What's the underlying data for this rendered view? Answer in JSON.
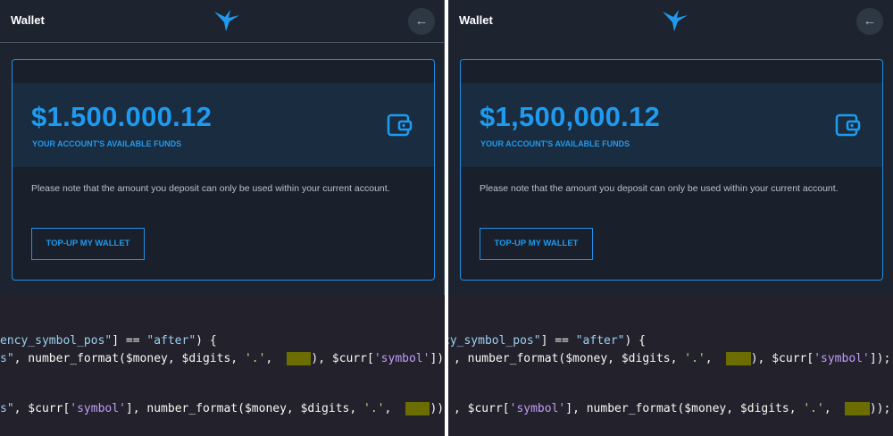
{
  "left": {
    "header": {
      "title": "Wallet",
      "back_icon": "arrow-left-icon",
      "logo_icon": "hummingbird-logo-icon"
    },
    "card": {
      "amount": "$1.500.000.12",
      "funds_label": "YOUR ACCOUNT'S AVAILABLE FUNDS",
      "note": "Please note that the amount you deposit can only be used within your current account.",
      "topup_label": "TOP-UP MY WALLET",
      "wallet_icon": "wallet-icon"
    },
    "code": {
      "line1_a": "ency_symbol_pos\"",
      "line1_b": "] == ",
      "line1_c": "\"after\"",
      "line1_d": ") {",
      "line2_a": "s\"",
      "line2_b": ", number_format($money, $digits, ",
      "line2_c": "'.'",
      "line2_d": ",  ",
      "line2_hl": "'.'",
      "line2_e": "), $curr[",
      "line2_f": "'symbol'",
      "line2_g": "]);",
      "line3_a": "s\"",
      "line3_b": ", $curr[",
      "line3_c": "'symbol'",
      "line3_d": "], number_format($money, $digits, ",
      "line3_e": "'.'",
      "line3_f": ",  ",
      "line3_hl": "'.'",
      "line3_g": "));"
    }
  },
  "right": {
    "header": {
      "title": "Wallet",
      "back_icon": "arrow-left-icon",
      "logo_icon": "hummingbird-logo-icon"
    },
    "card": {
      "amount": "$1,500,000.12",
      "funds_label": "YOUR ACCOUNT'S AVAILABLE FUNDS",
      "note": "Please note that the amount you deposit can only be used within your current account.",
      "topup_label": "TOP-UP MY WALLET",
      "wallet_icon": "wallet-icon"
    },
    "code": {
      "line1_a": "cy_symbol_pos\"",
      "line1_b": "] == ",
      "line1_c": "\"after\"",
      "line1_d": ") {",
      "line2_b": ", number_format($money, $digits, ",
      "line2_c": "'.'",
      "line2_d": ",  ",
      "line2_hl": "','",
      "line2_e": "), $curr[",
      "line2_f": "'symbol'",
      "line2_g": "]);",
      "line3_b": ", $curr[",
      "line3_c": "'symbol'",
      "line3_d": "], number_format($money, $digits, ",
      "line3_e": "'.'",
      "line3_f": ",  ",
      "line3_hl": "','",
      "line3_g": "));"
    }
  },
  "colors": {
    "accent": "#1e9bf0",
    "background": "#1d2430",
    "code_bg": "#22212c",
    "highlight": "#6b6d00"
  }
}
